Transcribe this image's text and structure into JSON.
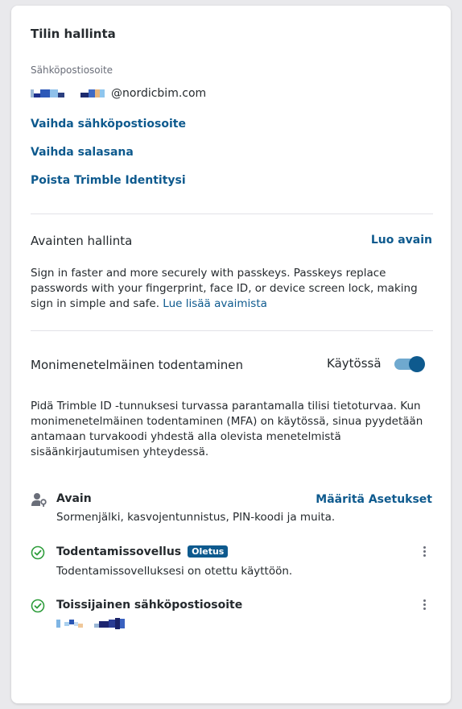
{
  "account": {
    "title": "Tilin hallinta",
    "email_label": "Sähköpostiosoite",
    "email_domain": "@nordicbim.com",
    "change_email": "Vaihda sähköpostiosoite",
    "change_password": "Vaihda salasana",
    "delete_identity": "Poista Trimble Identitysi"
  },
  "passkeys": {
    "title": "Avainten hallinta",
    "create_label": "Luo avain",
    "description": "Sign in faster and more securely with passkeys. Passkeys replace passwords with your fingerprint, face ID, or device screen lock, making sign in simple and safe.",
    "learn_more": "Lue lisää avaimista"
  },
  "mfa": {
    "title": "Monimenetelmäinen todentaminen",
    "status_label": "Käytössä",
    "enabled": true,
    "description": "Pidä Trimble ID -tunnuksesi turvassa parantamalla tilisi tietoturvaa. Kun monimenetelmäinen todentaminen (MFA) on käytössä, sinua pyydetään antamaan turvakoodi yhdestä alla olevista menetelmistä sisäänkirjautumisen yhteydessä."
  },
  "methods": [
    {
      "name": "Avain",
      "description": "Sormenjälki, kasvojentunnistus, PIN-koodi ja muita.",
      "action": "Määritä Asetukset",
      "icon": "user-key-icon"
    },
    {
      "name": "Todentamissovellus",
      "badge": "Oletus",
      "description": "Todentamissovelluksesi on otettu käyttöön.",
      "icon": "check-circle-icon"
    },
    {
      "name": "Toissijainen sähköpostiosoite",
      "icon": "check-circle-icon"
    }
  ],
  "colors": {
    "link": "#0e5a8e",
    "success": "#2e9d3b",
    "text": "#252a2e",
    "muted": "#6a6e79"
  }
}
